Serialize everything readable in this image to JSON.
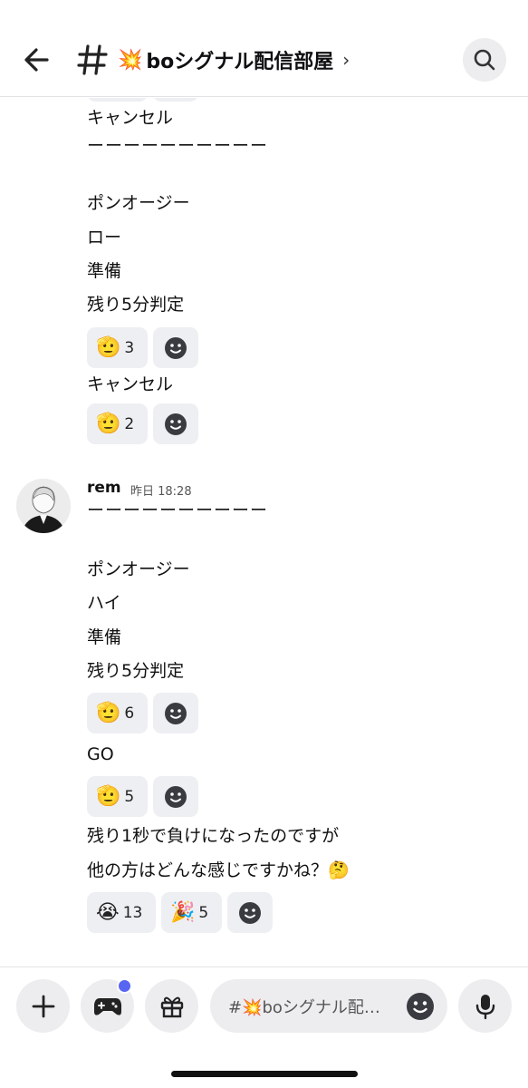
{
  "header": {
    "channel_emoji": "💥",
    "channel_name": "boシグナル配信部屋",
    "chevron": "›",
    "icons": [
      "back-arrow-icon",
      "hash-icon",
      "search-icon"
    ]
  },
  "messages": {
    "prev_block": {
      "lines": [
        "キャンセル",
        "ーーーーーーーーーー",
        "ポンオージー",
        "ロー",
        "準備",
        "残り5分判定"
      ],
      "reaction1": {
        "emoji": "🫡",
        "count": "3"
      },
      "line_after": "キャンセル",
      "reaction2": {
        "emoji": "🫡",
        "count": "2"
      }
    },
    "rem_message": {
      "author": "rem",
      "timestamp": "昨日 18:28",
      "lines": [
        "ーーーーーーーーーー",
        "ポンオージー",
        "ハイ",
        "準備",
        "残り5分判定"
      ],
      "reaction1": {
        "emoji": "🫡",
        "count": "6"
      },
      "go_line": "GO",
      "reaction2": {
        "emoji": "🫡",
        "count": "5"
      },
      "question_line1": "残り1秒で負けになったのですが",
      "question_line2": "他の方はどんな感じですかね？🤔",
      "reaction3": [
        {
          "emoji": "😭",
          "count": "13"
        },
        {
          "emoji": "🎉",
          "count": "5"
        }
      ]
    }
  },
  "bottom_bar": {
    "input_placeholder": "#💥boシグナル配…",
    "icons": [
      "plus-icon",
      "gamepad-icon",
      "gift-icon",
      "emoji-icon",
      "microphone-icon"
    ],
    "accent": "#5865f2"
  }
}
